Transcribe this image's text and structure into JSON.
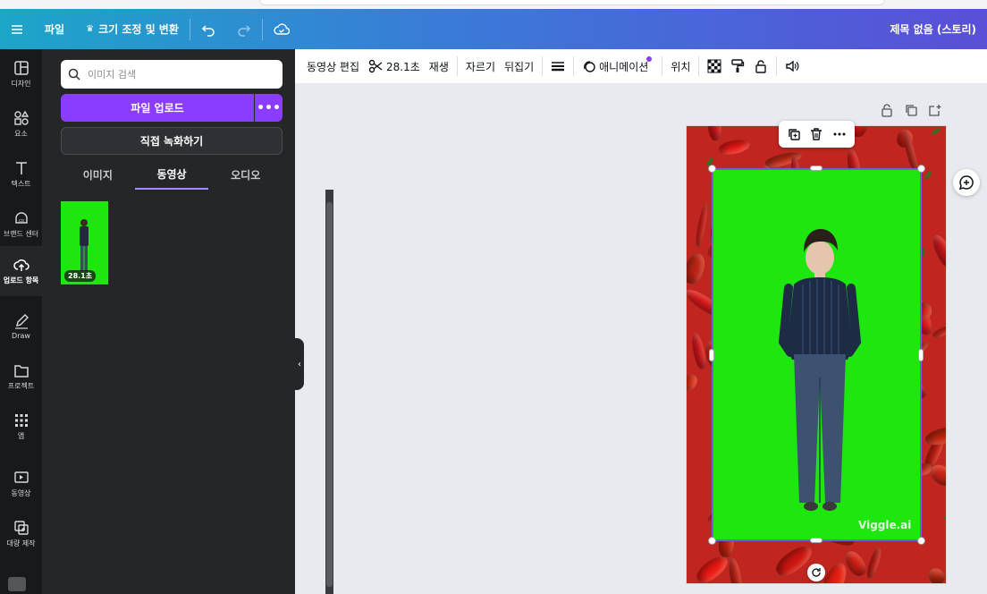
{
  "topbar": {
    "menu_icon": "hamburger-icon",
    "file": "파일",
    "resize": "크기 조정 및 변환",
    "title": "제목 없음 (스토리)"
  },
  "rail": [
    {
      "label": "디자인",
      "icon": "layout-icon"
    },
    {
      "label": "요소",
      "icon": "shapes-icon"
    },
    {
      "label": "텍스트",
      "icon": "text-icon"
    },
    {
      "label": "브랜드 센터",
      "icon": "brand-icon"
    },
    {
      "label": "업로드 항목",
      "icon": "cloud-upload-icon",
      "active": true
    },
    {
      "label": "Draw",
      "icon": "pen-icon"
    },
    {
      "label": "프로젝트",
      "icon": "folder-icon"
    },
    {
      "label": "앱",
      "icon": "apps-icon"
    },
    {
      "label": "동영상",
      "icon": "video-icon"
    },
    {
      "label": "대량 제작",
      "icon": "bulk-create-icon"
    }
  ],
  "panel": {
    "search_placeholder": "이미지 검색",
    "upload_button": "파일 업로드",
    "more": "•••",
    "record_button": "직접 녹화하기",
    "tabs": [
      "이미지",
      "동영상",
      "오디오"
    ],
    "active_tab": "동영상",
    "thumb_duration": "28.1초"
  },
  "toolbar": {
    "edit_video": "동영상 편집",
    "duration": "28.1초",
    "play": "재생",
    "crop": "자르기",
    "flip": "뒤집기",
    "animate": "애니메이션",
    "position": "위치"
  },
  "canvas": {
    "watermark": "Viggle.ai"
  },
  "colors": {
    "accent": "#8b3dff",
    "greenscreen": "#1ee60f"
  }
}
